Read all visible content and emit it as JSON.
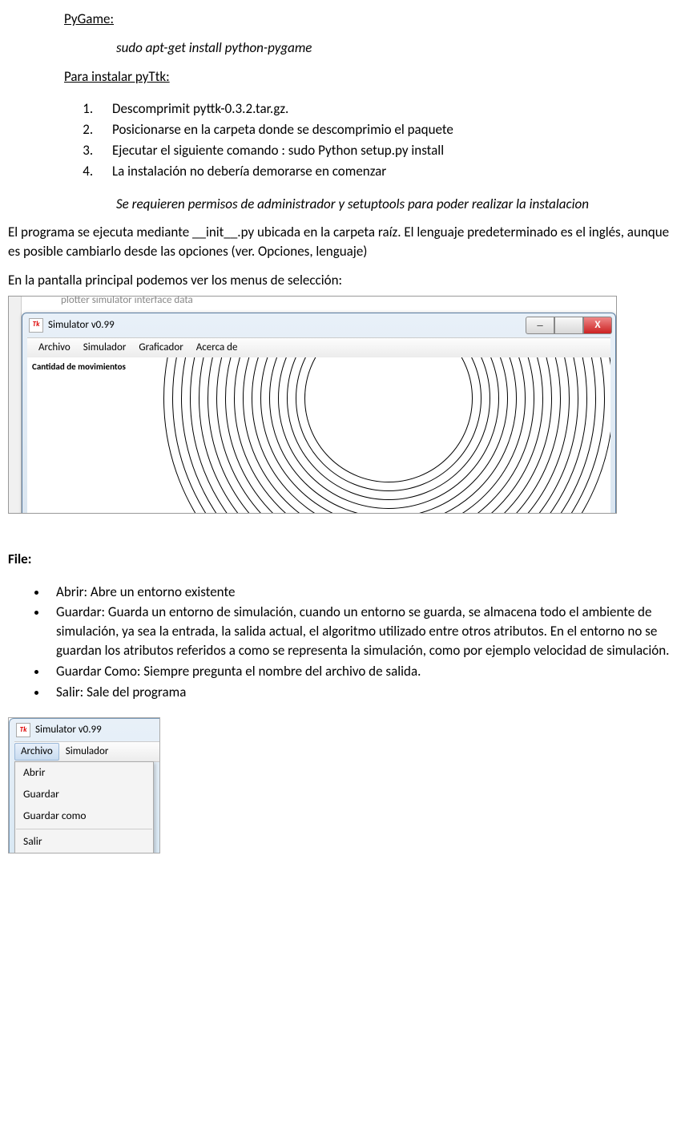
{
  "sections": {
    "pygame_heading": "PyGame:",
    "pygame_command": "sudo apt-get install python-pygame",
    "pyttk_heading": "Para instalar pyTtk:",
    "steps": [
      "Descomprimit pyttk-0.3.2.tar.gz.",
      "Posicionarse en la carpeta donde se descomprimio el paquete",
      "Ejecutar el siguiente comando : sudo Python setup.py install",
      "La instalación no debería demorarse en comenzar"
    ],
    "note": "Se requieren permisos de administrador y setuptools para poder realizar la instalacion",
    "paragraph1": "El programa se ejecuta mediante __init__.py ubicada en la carpeta raíz. El lenguaje predeterminado es el inglés, aunque es posible cambiarlo desde las opciones (ver. Opciones, lenguaje)",
    "paragraph2": "En la pantalla principal podemos ver los menus de selección:",
    "file_heading": "File:",
    "file_items": [
      "Abrir: Abre un entorno existente",
      "Guardar: Guarda un entorno de simulación, cuando un entorno se guarda, se almacena todo el ambiente de simulación, ya sea la entrada, la salida actual, el algoritmo utilizado entre otros atributos. En el entorno no se guardan los atributos referidos a como se representa la simulación, como por ejemplo velocidad de simulación.",
      "Guardar Como: Siempre pregunta el nombre del archivo de salida.",
      "Salir: Sale del programa"
    ]
  },
  "screenshot1": {
    "window_title": "Simulator v0.99",
    "bg_folders": "plotter        simulator       interface       data",
    "menus": [
      "Archivo",
      "Simulador",
      "Graficador",
      "Acerca de"
    ],
    "content_label": "Cantidad de movimientos"
  },
  "screenshot2": {
    "window_title": "Simulator v0.99",
    "menus": [
      "Archivo",
      "Simulador"
    ],
    "dropdown": [
      "Abrir",
      "Guardar",
      "Guardar como",
      "Salir"
    ]
  }
}
